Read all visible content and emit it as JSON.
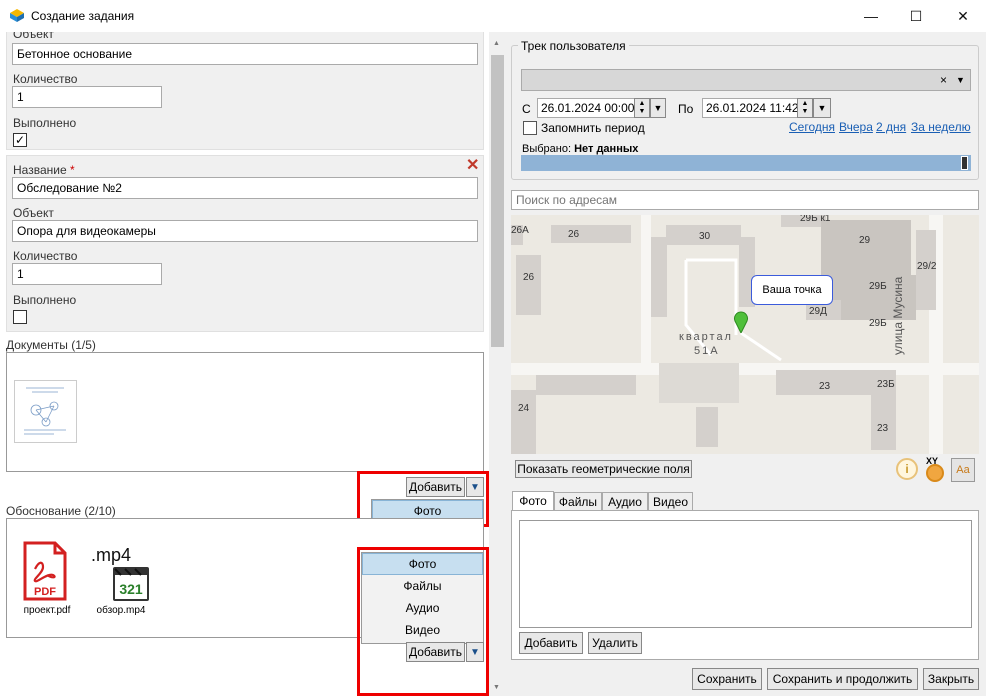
{
  "window": {
    "title": "Создание задания",
    "minimize": "—",
    "maximize": "☐",
    "close": "✕"
  },
  "task1": {
    "object_label": "Объект",
    "object_value": "Бетонное основание",
    "qty_label": "Количество",
    "qty_value": "1",
    "done_label": "Выполнено",
    "done_mark": "✓"
  },
  "task2": {
    "name_label": "Название",
    "required_mark": "*",
    "name_value": "Обследование №2",
    "object_label": "Объект",
    "object_value": "Опора для видеокамеры",
    "qty_label": "Количество",
    "qty_value": "1",
    "done_label": "Выполнено",
    "done_mark": "",
    "delete_icon": "✕"
  },
  "documents": {
    "label": "Документы (1/5)",
    "add_label": "Добавить",
    "menu": [
      "Фото"
    ]
  },
  "basis": {
    "label": "Обоснование (2/10)",
    "files": [
      {
        "name": "проект.pdf",
        "badge": "PDF"
      },
      {
        "name": "обзор.mp4",
        "badge": ".mp4",
        "counter": "321"
      }
    ],
    "add_label": "Добавить",
    "menu": [
      "Фото",
      "Файлы",
      "Аудио",
      "Видео"
    ]
  },
  "track": {
    "group_label": "Трек пользователя",
    "combo_clear": "×",
    "from_label": "С",
    "from_value": "26.01.2024 00:00",
    "to_label": "По",
    "to_value": "26.01.2024 11:42",
    "remember_label": "Запомнить период",
    "quick": [
      "Сегодня",
      "Вчера",
      "2 дня",
      "За неделю"
    ],
    "selected_prefix": "Выбрано:",
    "selected_value": "Нет данных"
  },
  "search": {
    "placeholder": "Поиск по адресам"
  },
  "map": {
    "labels": [
      "26А",
      "26",
      "30",
      "29Б к1",
      "29",
      "29/2",
      "26",
      "29Б",
      "29Д",
      "29Б",
      "квартал",
      "51А",
      "24",
      "23",
      "23Б",
      "23",
      "улица Мусина"
    ],
    "marker_label": "Ваша точка",
    "geo_button": "Показать геометрические поля",
    "info_icon": "i",
    "xy_label": "XY",
    "aa_label": "Aa"
  },
  "attachments": {
    "tabs": [
      "Фото",
      "Файлы",
      "Аудио",
      "Видео"
    ],
    "add_label": "Добавить",
    "delete_label": "Удалить"
  },
  "footer": {
    "save": "Сохранить",
    "save_continue": "Сохранить и продолжить",
    "close": "Закрыть"
  }
}
